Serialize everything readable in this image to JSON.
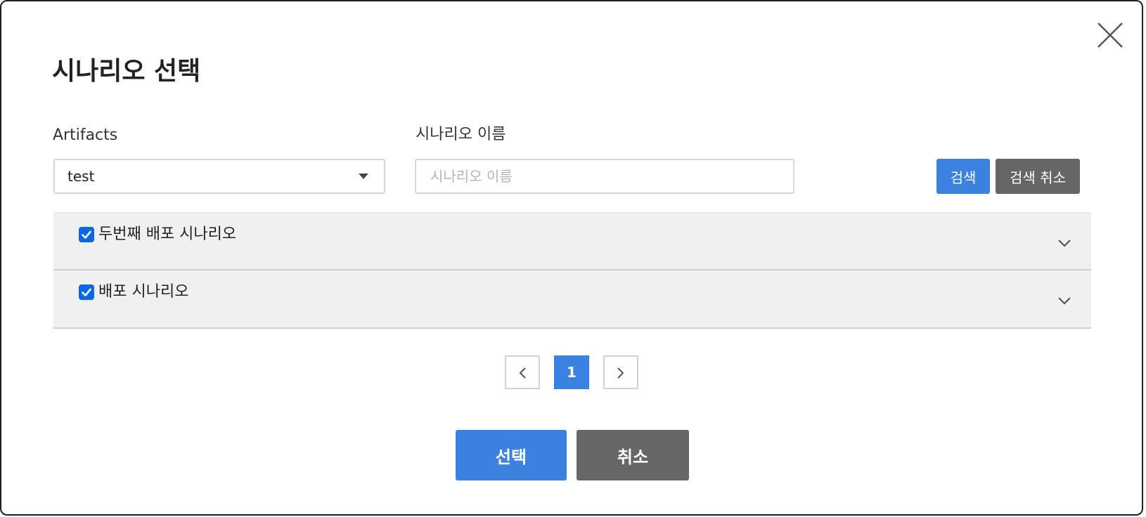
{
  "dialog": {
    "title": "시나리오 선택",
    "close_icon": "close-icon"
  },
  "filters": {
    "artifacts_label": "Artifacts",
    "artifacts_value": "test",
    "scenario_name_label": "시나리오 이름",
    "scenario_name_placeholder": "시나리오 이름",
    "scenario_name_value": "",
    "search_label": "검색",
    "search_cancel_label": "검색 취소"
  },
  "scenarios": [
    {
      "label": "두번째 배포 시나리오",
      "checked": true
    },
    {
      "label": "배포 시나리오",
      "checked": true
    }
  ],
  "pagination": {
    "current_page": "1"
  },
  "footer": {
    "select_label": "선택",
    "cancel_label": "취소"
  },
  "colors": {
    "primary": "#3b82e0",
    "secondary": "#666666",
    "checkbox": "#0b67e8",
    "list_bg": "#f0f0f0"
  }
}
